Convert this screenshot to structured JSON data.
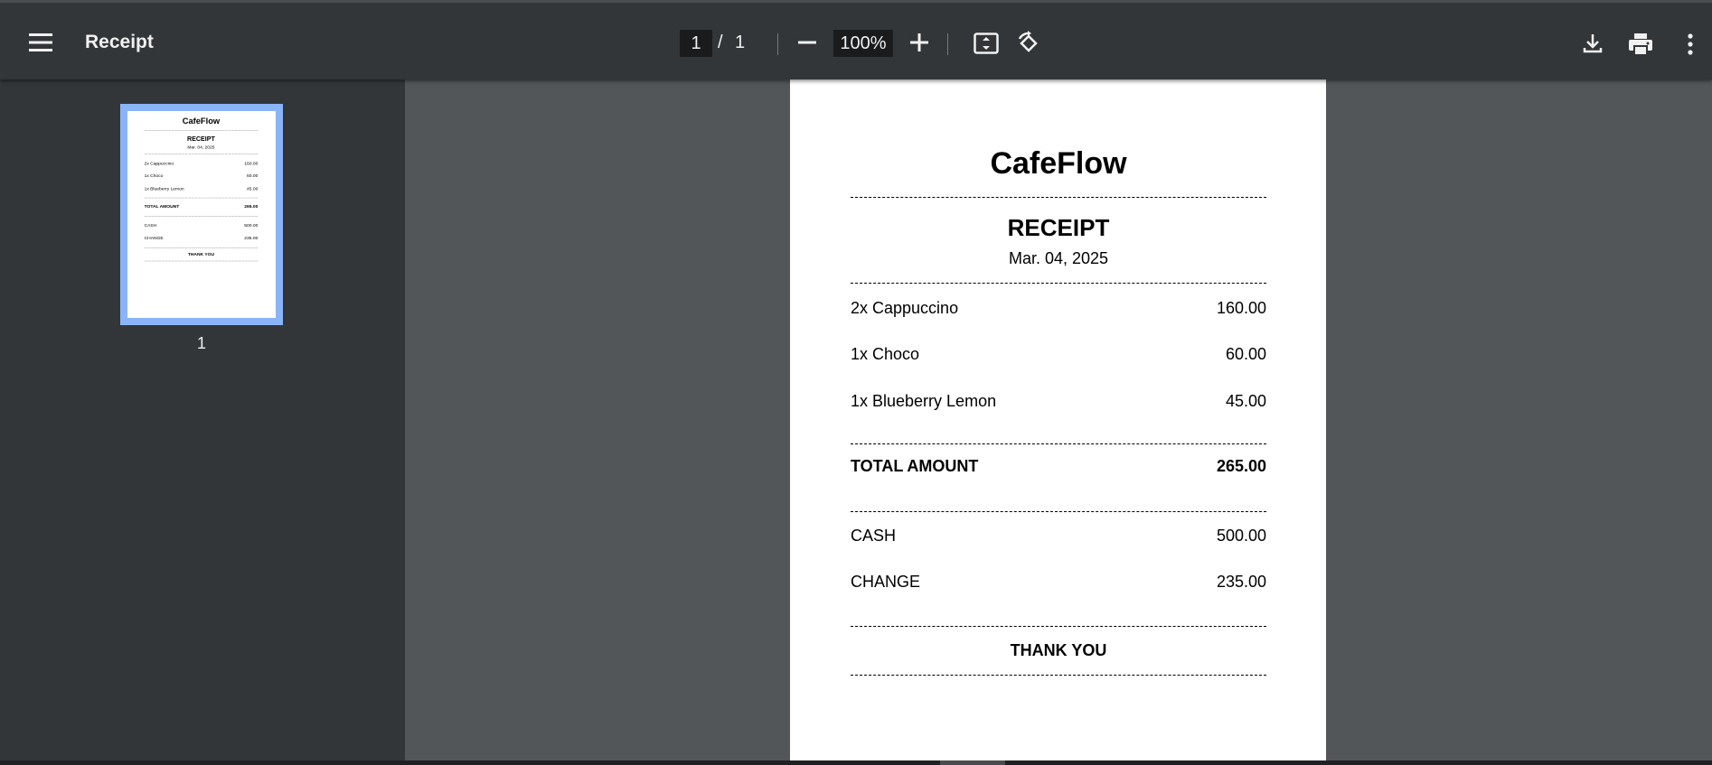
{
  "toolbar": {
    "title": "Receipt",
    "current_page": "1",
    "page_separator": "/",
    "total_pages": "1",
    "zoom": "100%"
  },
  "sidebar": {
    "thumbnails": [
      {
        "label": "1"
      }
    ]
  },
  "receipt": {
    "store_name": "CafeFlow",
    "heading": "RECEIPT",
    "date": "Mar. 04, 2025",
    "items": [
      {
        "description": "2x Cappuccino",
        "amount": "160.00"
      },
      {
        "description": "1x Choco",
        "amount": "60.00"
      },
      {
        "description": "1x Blueberry Lemon",
        "amount": "45.00"
      }
    ],
    "total_label": "TOTAL AMOUNT",
    "total_amount": "265.00",
    "cash_label": "CASH",
    "cash_amount": "500.00",
    "change_label": "CHANGE",
    "change_amount": "235.00",
    "footer": "THANK YOU"
  },
  "icons": {
    "menu": "menu-icon",
    "zoom_out": "minus-icon",
    "zoom_in": "plus-icon",
    "fit": "fit-to-page-icon",
    "rotate": "rotate-icon",
    "download": "download-icon",
    "print": "print-icon",
    "more": "more-vertical-icon"
  },
  "colors": {
    "toolbar_bg": "#323639",
    "viewer_bg": "#525659",
    "thumb_highlight": "#8ab4f8",
    "text_light": "#f1f1f1"
  }
}
